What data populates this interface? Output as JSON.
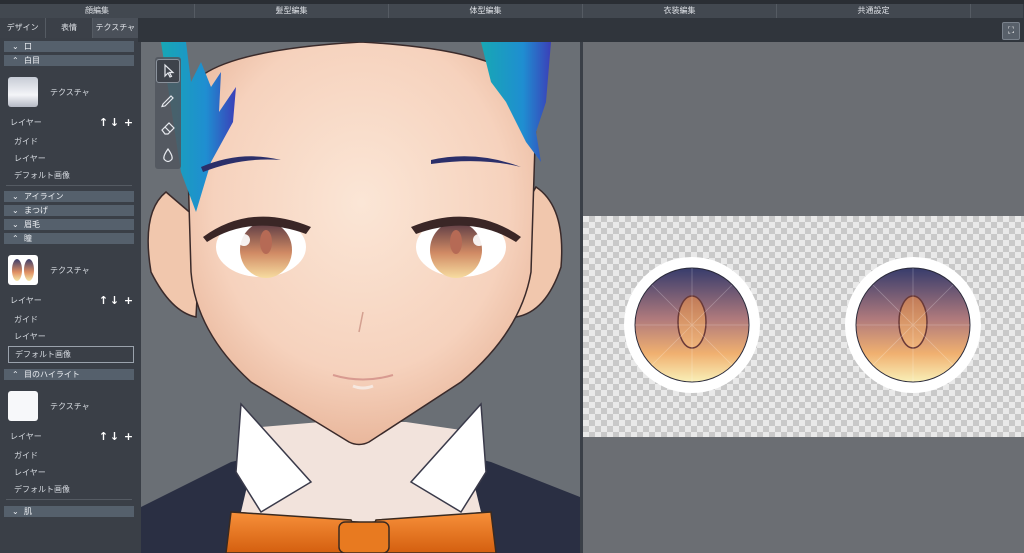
{
  "mode_tabs": [
    "顔編集",
    "髪型編集",
    "体型編集",
    "衣装編集",
    "共通設定"
  ],
  "sub_tabs": [
    "デザイン",
    "表情",
    "テクスチャ"
  ],
  "sidebar": {
    "sections": [
      {
        "title": "口",
        "expanded": false
      },
      {
        "title": "白目",
        "expanded": true,
        "texture_label": "テクスチャ",
        "layer_label": "レイヤー",
        "items": [
          "ガイド",
          "レイヤー",
          "デフォルト画像"
        ]
      },
      {
        "title": "アイライン",
        "expanded": false
      },
      {
        "title": "まつげ",
        "expanded": false
      },
      {
        "title": "眉毛",
        "expanded": false
      },
      {
        "title": "瞳",
        "expanded": true,
        "texture_label": "テクスチャ",
        "layer_label": "レイヤー",
        "items": [
          "ガイド",
          "レイヤー",
          "デフォルト画像"
        ],
        "selected": "デフォルト画像"
      },
      {
        "title": "目のハイライト",
        "expanded": true,
        "texture_label": "テクスチャ",
        "layer_label": "レイヤー",
        "items": [
          "ガイド",
          "レイヤー",
          "デフォルト画像"
        ]
      },
      {
        "title": "肌",
        "expanded": false
      }
    ]
  },
  "icons": {
    "collapsed": "chevron-down-icon",
    "expanded": "chevron-up-icon",
    "move_up": "arrow-up-icon",
    "move_down": "arrow-down-icon",
    "add": "plus-icon"
  },
  "tools": [
    "select-tool-icon",
    "pen-tool-icon",
    "eraser-tool-icon",
    "fill-tool-icon"
  ],
  "colors": {
    "panel": "#3a3f47",
    "section_header": "#55606c",
    "viewport_bg": "#6a6f75",
    "hair": "#2aa6c8",
    "iris_dark": "#3b3f6e",
    "iris_light": "#f5e7a6",
    "bow": "#e8731c"
  }
}
